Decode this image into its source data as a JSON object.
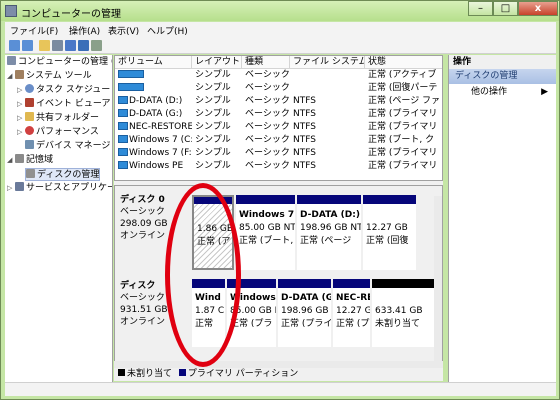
{
  "window": {
    "title": "コンピューターの管理",
    "min": "–",
    "max": "□",
    "close": "x"
  },
  "menu": [
    "ファイル(F)",
    "操作(A)",
    "表示(V)",
    "ヘルプ(H)"
  ],
  "tree": {
    "root": "コンピューターの管理 (ロ",
    "system_tools": "システム ツール",
    "task_scheduler": "タスク スケジュー",
    "event_viewer": "イベント ビューア",
    "shared_folders": "共有フォルダー",
    "performance": "パフォーマンス",
    "device_manager": "デバイス マネージ",
    "storage": "記憶域",
    "disk_management": "ディスクの管理",
    "services": "サービスとアプリケー"
  },
  "volumes": {
    "headers": [
      "ボリューム",
      "レイアウト",
      "種類",
      "ファイル システム",
      "状態"
    ],
    "rows": [
      [
        "",
        "シンプル",
        "ベーシック",
        "",
        "正常 (アクティブ"
      ],
      [
        "",
        "シンプル",
        "ベーシック",
        "",
        "正常 (回復パーテ"
      ],
      [
        "D-DATA (D:)",
        "シンプル",
        "ベーシック",
        "NTFS",
        "正常 (ページ ファ"
      ],
      [
        "D-DATA (G:)",
        "シンプル",
        "ベーシック",
        "NTFS",
        "正常 (プライマリ"
      ],
      [
        "NEC-RESTORE",
        "シンプル",
        "ベーシック",
        "NTFS",
        "正常 (プライマリ"
      ],
      [
        "Windows 7 (C:)",
        "シンプル",
        "ベーシック",
        "NTFS",
        "正常 (ブート, ク"
      ],
      [
        "Windows 7 (F:)",
        "シンプル",
        "ベーシック",
        "NTFS",
        "正常 (プライマリ"
      ],
      [
        "Windows PE",
        "シンプル",
        "ベーシック",
        "NTFS",
        "正常 (プライマリ"
      ]
    ]
  },
  "disks": [
    {
      "name": "ディスク 0",
      "type": "ベーシック",
      "size": "298.09 GB",
      "status": "オンライン",
      "partitions": [
        {
          "title": "",
          "size": "1.86 GB",
          "status": "正常 (ア"
        },
        {
          "title": "Windows 7",
          "size": "85.00 GB NTI",
          "status": "正常 (ブート,"
        },
        {
          "title": "D-DATA  (D:)",
          "size": "198.96 GB NT",
          "status": "正常 (ページ"
        },
        {
          "title": "",
          "size": "12.27 GB",
          "status": "正常 (回復"
        }
      ]
    },
    {
      "name": "ディスク",
      "type": "ベーシック",
      "size": "931.51 GB",
      "status": "オンライン",
      "partitions": [
        {
          "title": "Wind",
          "size": "1.87 C",
          "status": "正常"
        },
        {
          "title": "Windows",
          "size": "85.00 GB N",
          "status": "正常 (プラ"
        },
        {
          "title": "D-DATA  (G",
          "size": "198.96 GB",
          "status": "正常 (プライ"
        },
        {
          "title": "NEC-RE",
          "size": "12.27 G",
          "status": "正常 (プ"
        },
        {
          "title": "",
          "size": "633.41 GB",
          "status": "未割り当て"
        }
      ]
    }
  ],
  "legend": {
    "unallocated": "未割り当て",
    "primary": "プライマリ パーティション"
  },
  "actions": {
    "header": "操作",
    "section": "ディスクの管理",
    "more": "他の操作",
    "arrow": "▶"
  },
  "colors": {
    "primary_partition": "#06067a",
    "unallocated": "#000000",
    "annotation_circle": "#e00010"
  }
}
